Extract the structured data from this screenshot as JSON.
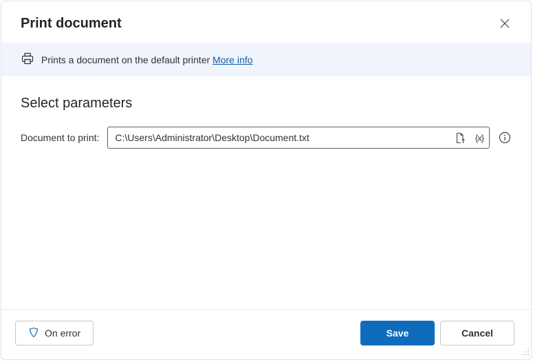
{
  "header": {
    "title": "Print document"
  },
  "infoBar": {
    "text": "Prints a document on the default printer ",
    "linkText": "More info"
  },
  "parameters": {
    "sectionTitle": "Select parameters",
    "documentLabel": "Document to print:",
    "documentValue": "C:\\Users\\Administrator\\Desktop\\Document.txt",
    "variableToken": "{x}"
  },
  "footer": {
    "onError": "On error",
    "save": "Save",
    "cancel": "Cancel"
  }
}
